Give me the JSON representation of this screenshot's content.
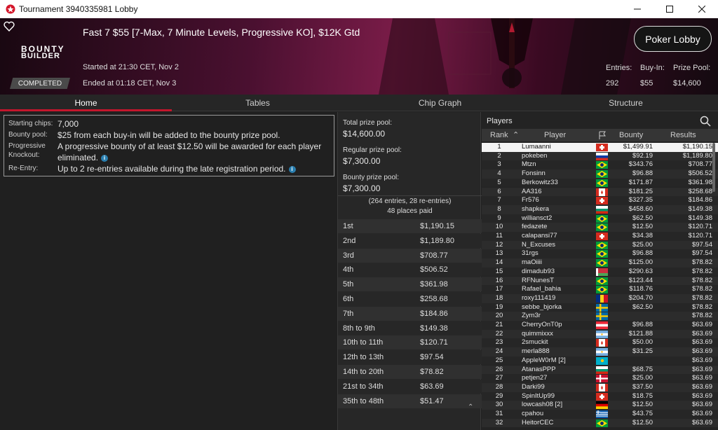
{
  "window": {
    "title": "Tournament 3940335981 Lobby"
  },
  "banner": {
    "tournament_name": "Fast 7 $55 [7-Max, 7 Minute Levels, Progressive KO], $12K Gtd",
    "logo_line1": "BOUNTY",
    "logo_line2": "BUILDER",
    "started": "Started at 21:30 CET, Nov 2",
    "ended": "Ended at 01:18 CET, Nov 3",
    "status": "COMPLETED",
    "lobby_button": "Poker Lobby",
    "entries_label": "Entries:",
    "entries_value": "292",
    "buyin_label": "Buy-In:",
    "buyin_value": "$55",
    "prizepool_label": "Prize Pool:",
    "prizepool_value": "$14,600"
  },
  "tabs": [
    "Home",
    "Tables",
    "Chip Graph",
    "Structure"
  ],
  "info": {
    "starting_chips_label": "Starting chips:",
    "starting_chips": "7,000",
    "bounty_label": "Bounty pool:",
    "bounty": "$25 from each buy-in will be added to the bounty prize pool.",
    "pko_label1": "Progressive",
    "pko_label2": "Knockout:",
    "pko_line1": "A progressive bounty of at least $12.50 will be awarded for each player",
    "pko_line2": "eliminated.",
    "reentry_label": "Re-Entry:",
    "reentry": "Up to 2 re-entries available during the late registration period."
  },
  "prize": {
    "total_label": "Total prize pool:",
    "total": "$14,600.00",
    "regular_label": "Regular prize pool:",
    "regular": "$7,300.00",
    "bounty_label": "Bounty prize pool:",
    "bounty": "$7,300.00",
    "entries_note": "(264 entries, 28 re-entries)",
    "places_paid": "48 places paid",
    "payouts": [
      [
        "1st",
        "$1,190.15"
      ],
      [
        "2nd",
        "$1,189.80"
      ],
      [
        "3rd",
        "$708.77"
      ],
      [
        "4th",
        "$506.52"
      ],
      [
        "5th",
        "$361.98"
      ],
      [
        "6th",
        "$258.68"
      ],
      [
        "7th",
        "$184.86"
      ],
      [
        "8th to 9th",
        "$149.38"
      ],
      [
        "10th to 11th",
        "$120.71"
      ],
      [
        "12th to 13th",
        "$97.54"
      ],
      [
        "14th to 20th",
        "$78.82"
      ],
      [
        "21st to 34th",
        "$63.69"
      ],
      [
        "35th to 48th",
        "$51.47"
      ]
    ]
  },
  "players": {
    "title": "Players",
    "col_rank": "Rank",
    "col_player": "Player",
    "col_bounty": "Bounty",
    "col_results": "Results",
    "rows": [
      [
        "1",
        "Lumaanni",
        "ch",
        "$1,499.91",
        "$1,190.15"
      ],
      [
        "2",
        "pokeben",
        "ru",
        "$92.19",
        "$1,189.80"
      ],
      [
        "3",
        "Mtzn",
        "br",
        "$343.76",
        "$708.77"
      ],
      [
        "4",
        "Fonsinn",
        "br",
        "$96.88",
        "$506.52"
      ],
      [
        "5",
        "Berkowitz33",
        "br",
        "$171.87",
        "$361.98"
      ],
      [
        "6",
        "AA316",
        "ca",
        "$181.25",
        "$258.68"
      ],
      [
        "7",
        "Fr576",
        "ch",
        "$327.35",
        "$184.86"
      ],
      [
        "8",
        "shapkera",
        "bg",
        "$458.60",
        "$149.38"
      ],
      [
        "9",
        "williansct2",
        "br",
        "$62.50",
        "$149.38"
      ],
      [
        "10",
        "fedazete",
        "br",
        "$12.50",
        "$120.71"
      ],
      [
        "11",
        "calapansi77",
        "ch",
        "$34.38",
        "$120.71"
      ],
      [
        "12",
        "N_Excuses",
        "br",
        "$25.00",
        "$97.54"
      ],
      [
        "13",
        "31rgs",
        "br",
        "$96.88",
        "$97.54"
      ],
      [
        "14",
        "maOiiii",
        "br",
        "$125.00",
        "$78.82"
      ],
      [
        "15",
        "dimadub93",
        "by",
        "$290.63",
        "$78.82"
      ],
      [
        "16",
        "RFNunesT",
        "br",
        "$123.44",
        "$78.82"
      ],
      [
        "17",
        "Rafael_bahia",
        "br",
        "$118.76",
        "$78.82"
      ],
      [
        "18",
        "roxy111419",
        "ro",
        "$204.70",
        "$78.82"
      ],
      [
        "19",
        "sebbe_bjorka",
        "se",
        "$62.50",
        "$78.82"
      ],
      [
        "20",
        "Zym3r",
        "se",
        "",
        "$78.82"
      ],
      [
        "21",
        "CherryOnT0p",
        "at",
        "$96.88",
        "$63.69"
      ],
      [
        "22",
        "quimmixxx",
        "ar",
        "$121.88",
        "$63.69"
      ],
      [
        "23",
        "2smuckit",
        "ca",
        "$50.00",
        "$63.69"
      ],
      [
        "24",
        "merla888",
        "ar",
        "$31.25",
        "$63.69"
      ],
      [
        "25",
        "AppleW0rM [2]",
        "kz",
        "",
        "$63.69"
      ],
      [
        "26",
        "AtanasPPP",
        "bg",
        "$68.75",
        "$63.69"
      ],
      [
        "27",
        "petjen27",
        "dk",
        "$25.00",
        "$63.69"
      ],
      [
        "28",
        "Darki99",
        "ca",
        "$37.50",
        "$63.69"
      ],
      [
        "29",
        "SpinItUp99",
        "ch",
        "$18.75",
        "$63.69"
      ],
      [
        "30",
        "lowcash08 [2]",
        "de",
        "$12.50",
        "$63.69"
      ],
      [
        "31",
        "cpahou",
        "gr",
        "$43.75",
        "$63.69"
      ],
      [
        "32",
        "HeitorCEC",
        "br",
        "$12.50",
        "$63.69"
      ]
    ]
  }
}
